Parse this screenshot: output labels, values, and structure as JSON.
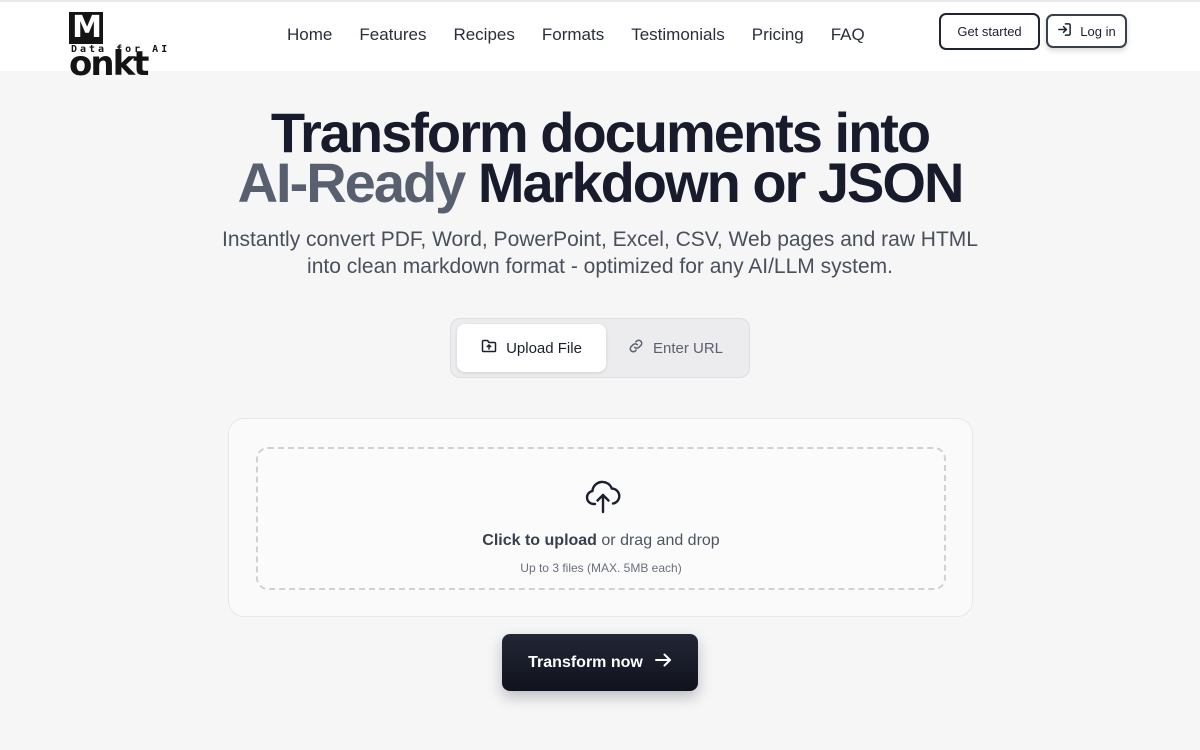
{
  "brand": {
    "wordmark_first": "M",
    "wordmark_rest": "onkt",
    "tagline": "Data for AI"
  },
  "nav": {
    "items": [
      {
        "label": "Home"
      },
      {
        "label": "Features"
      },
      {
        "label": "Recipes"
      },
      {
        "label": "Formats"
      },
      {
        "label": "Testimonials"
      },
      {
        "label": "Pricing"
      },
      {
        "label": "FAQ"
      }
    ],
    "get_started": "Get started",
    "login": "Log in"
  },
  "hero": {
    "title_line1": "Transform documents into",
    "title_accent": "AI-Ready",
    "title_line2_rest": " Markdown or JSON",
    "subtitle_line1": "Instantly convert PDF, Word, PowerPoint, Excel, CSV, Web pages and raw HTML",
    "subtitle_line2": "into clean markdown format - optimized for any AI/LLM system."
  },
  "source_toggle": {
    "upload_label": "Upload File",
    "url_label": "Enter URL",
    "selected": "Upload File"
  },
  "upload": {
    "click_label": "Click to upload",
    "drag_label": " or drag and drop",
    "hint": "Up to 3 files (MAX. 5MB each)"
  },
  "cta": {
    "label": "Transform now"
  },
  "colors": {
    "accent_gray": "#586070",
    "primary_dark": "#171b2b"
  }
}
